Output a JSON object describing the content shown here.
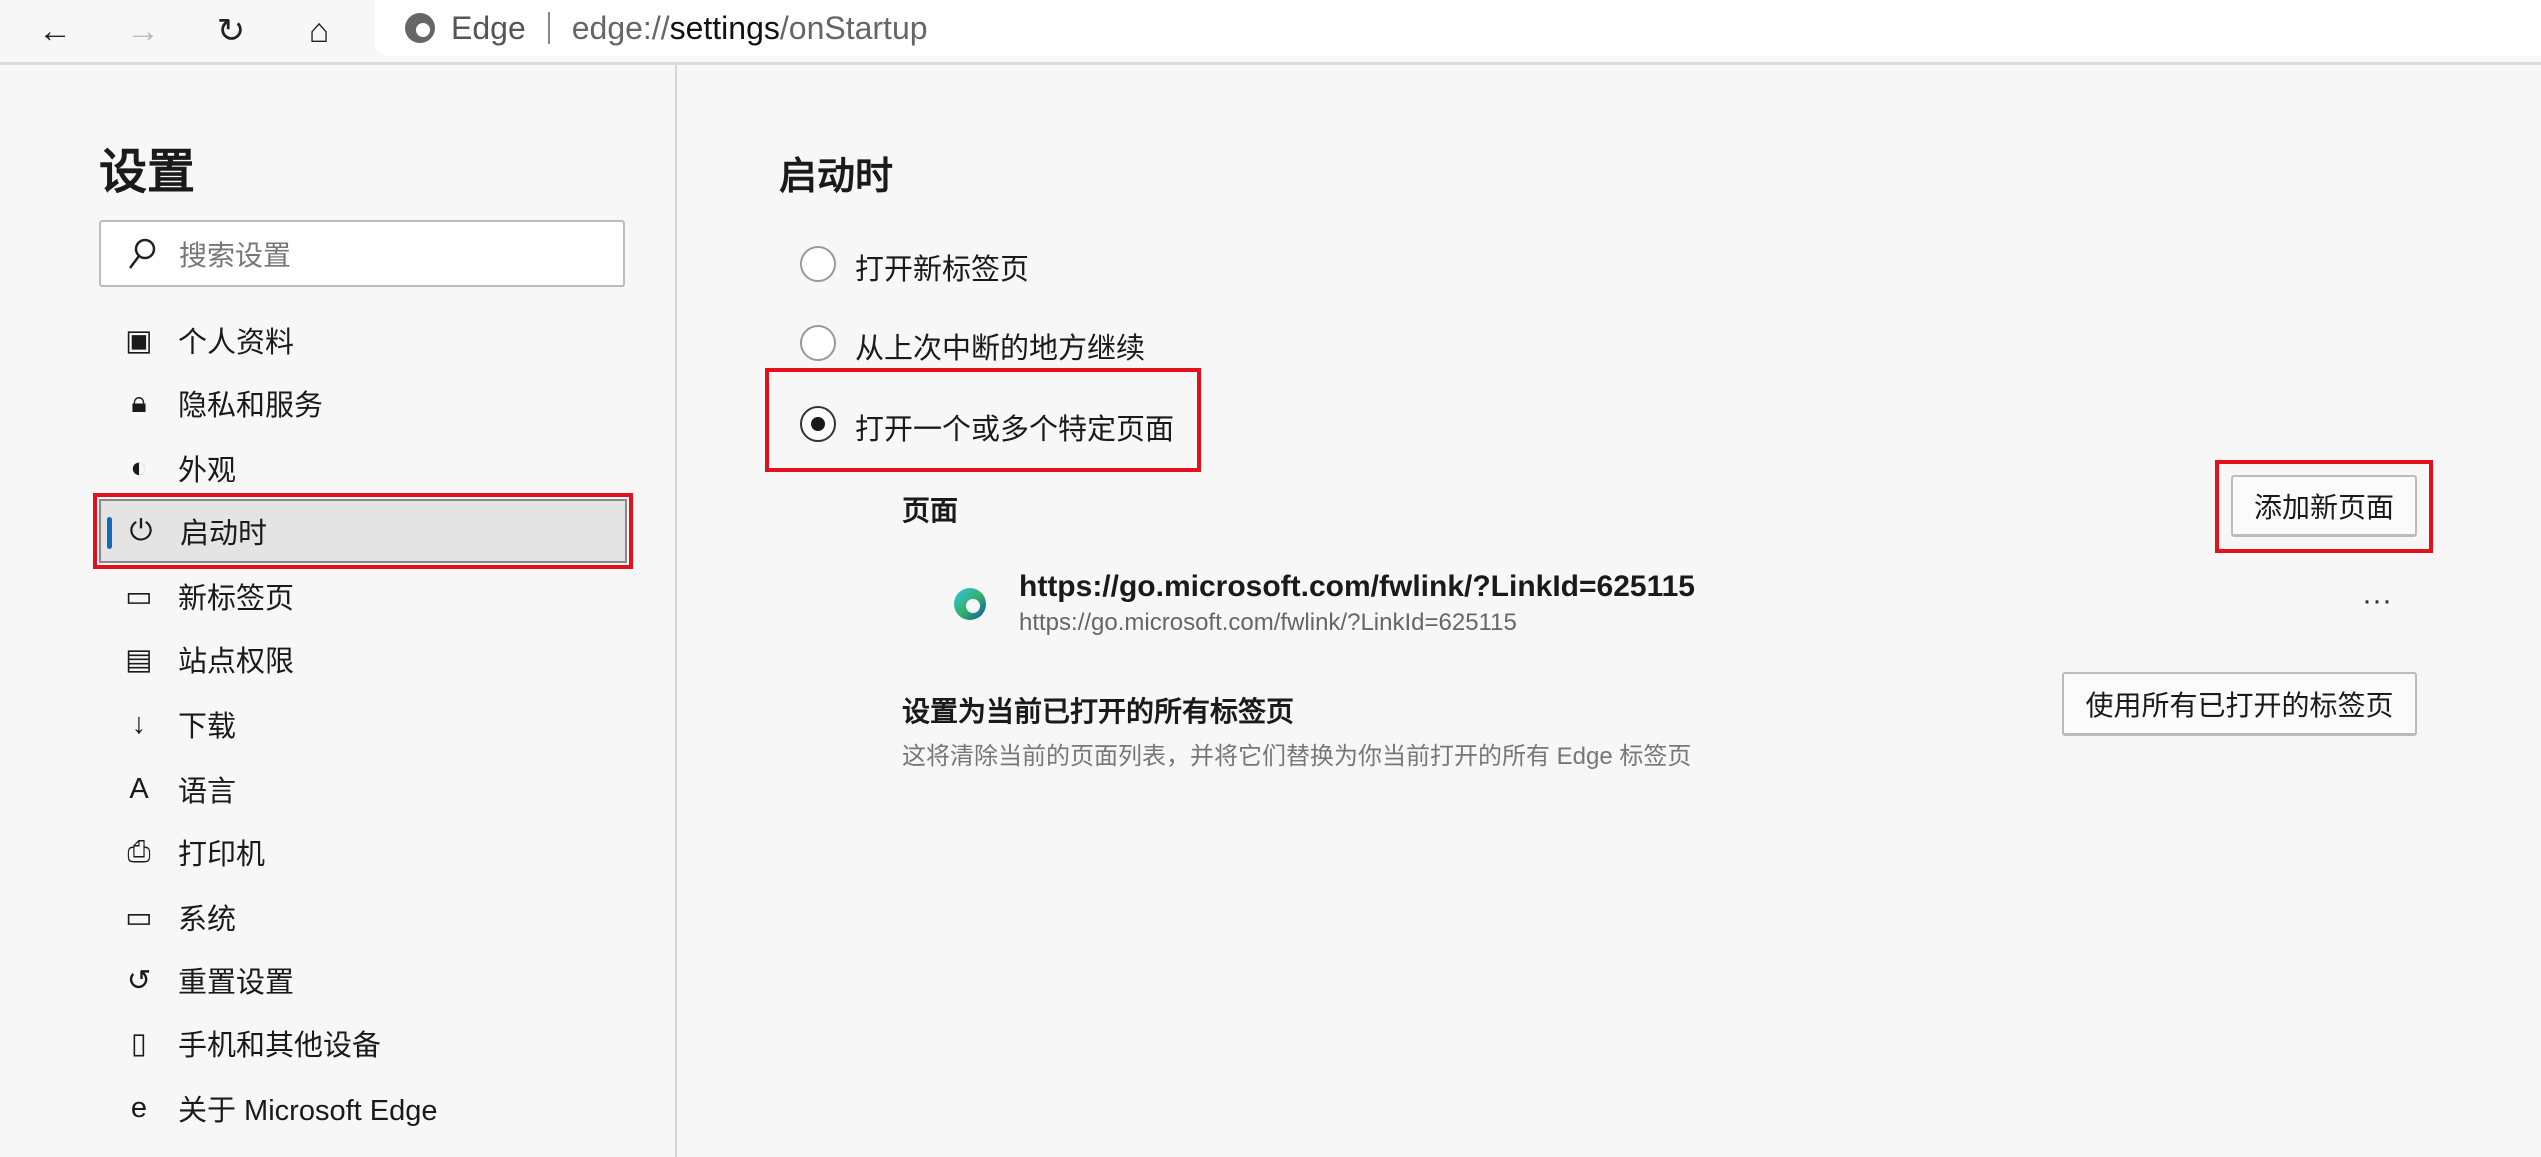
{
  "browser": {
    "brand": "Edge",
    "url_scheme": "edge://",
    "url_host": "settings",
    "url_path": "/onStartup"
  },
  "sidebar": {
    "title": "设置",
    "search_placeholder": "搜索设置",
    "items": [
      {
        "label": "个人资料",
        "icon": "profile-icon"
      },
      {
        "label": "隐私和服务",
        "icon": "lock-icon"
      },
      {
        "label": "外观",
        "icon": "palette-icon"
      },
      {
        "label": "启动时",
        "icon": "power-icon",
        "selected": true
      },
      {
        "label": "新标签页",
        "icon": "new-tab-icon"
      },
      {
        "label": "站点权限",
        "icon": "site-permissions-icon"
      },
      {
        "label": "下载",
        "icon": "download-icon"
      },
      {
        "label": "语言",
        "icon": "language-icon"
      },
      {
        "label": "打印机",
        "icon": "printer-icon"
      },
      {
        "label": "系统",
        "icon": "laptop-icon"
      },
      {
        "label": "重置设置",
        "icon": "reset-icon"
      },
      {
        "label": "手机和其他设备",
        "icon": "phone-icon"
      },
      {
        "label": "关于 Microsoft Edge",
        "icon": "edge-logo-icon"
      }
    ]
  },
  "main": {
    "title": "启动时",
    "options": [
      {
        "label": "打开新标签页",
        "checked": false
      },
      {
        "label": "从上次中断的地方继续",
        "checked": false
      },
      {
        "label": "打开一个或多个特定页面",
        "checked": true
      }
    ],
    "pages_label": "页面",
    "add_page_button": "添加新页面",
    "page_entry": {
      "title": "https://go.microsoft.com/fwlink/?LinkId=625115",
      "url": "https://go.microsoft.com/fwlink/?LinkId=625115",
      "more": "···"
    },
    "use_open_tabs": {
      "title": "设置为当前已打开的所有标签页",
      "description": "这将清除当前的页面列表，并将它们替换为你当前打开的所有 Edge 标签页",
      "button": "使用所有已打开的标签页"
    }
  },
  "colors": {
    "highlight": "#e4101b",
    "accent": "#0f6cbd"
  }
}
